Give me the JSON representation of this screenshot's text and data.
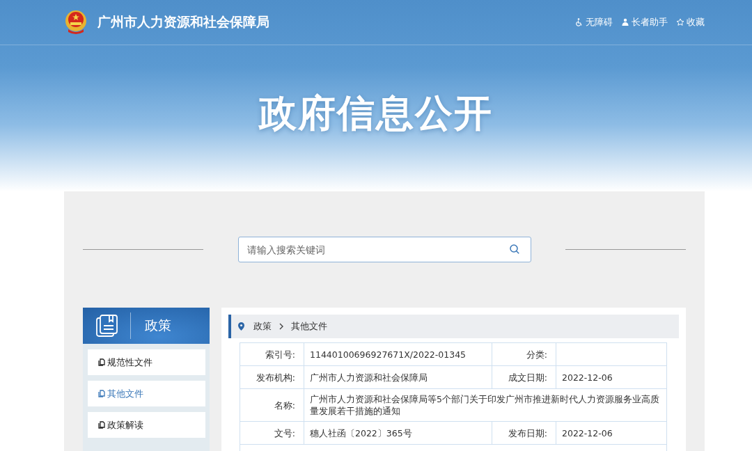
{
  "header": {
    "site_title": "广州市人力资源和社会保障局",
    "utility_links": [
      {
        "kind": "accessibility",
        "label": "无障碍"
      },
      {
        "kind": "elderly",
        "label": "长者助手"
      },
      {
        "kind": "favorite",
        "label": "收藏"
      }
    ],
    "banner_title": "政府信息公开"
  },
  "search": {
    "placeholder": "请输入搜索关键词"
  },
  "sidebar": {
    "title": "政策",
    "items": [
      {
        "label": "规范性文件",
        "selected": false
      },
      {
        "label": "其他文件",
        "selected": true
      },
      {
        "label": "政策解读",
        "selected": false
      }
    ]
  },
  "breadcrumb": [
    "政策",
    "其他文件"
  ],
  "info_table": [
    {
      "kind": "pair",
      "cells": [
        {
          "label": "索引号:",
          "value": "11440100696927671X/2022-01345"
        },
        {
          "label": "分类:"
        }
      ]
    },
    {
      "kind": "pair",
      "cells": [
        {
          "label": "发布机构:",
          "value": "广州市人力资源和社会保障局"
        },
        {
          "label": "成文日期:",
          "value": "2022-12-06"
        }
      ]
    },
    {
      "kind": "wide",
      "cells": [
        {
          "label": "名称:",
          "value": "广州市人力资源和社会保障局等5个部门关于印发广州市推进新时代人力资源服务业高质量发展若干措施的通知"
        }
      ]
    },
    {
      "kind": "pair",
      "cells": [
        {
          "label": "文号:",
          "value": "穗人社函〔2022〕365号"
        },
        {
          "label": "发布日期:",
          "value": "2022-12-06"
        }
      ]
    },
    {
      "kind": "blank"
    }
  ]
}
